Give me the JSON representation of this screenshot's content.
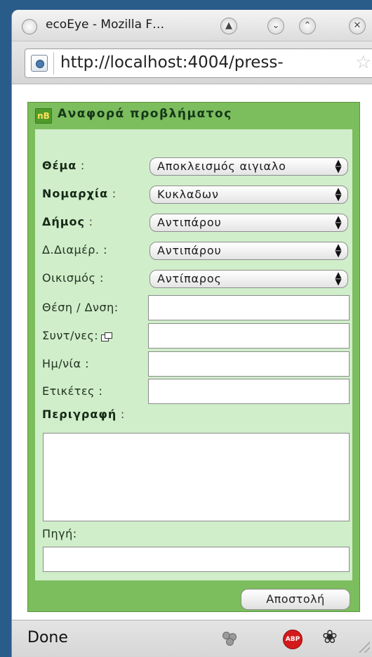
{
  "window": {
    "title": "ecoEye - Mozilla F…",
    "url": "http://localhost:4004/press-"
  },
  "panel": {
    "title": "Αναφορά προβλήματος",
    "logo_text": "nB"
  },
  "form": {
    "theme_label": "Θέμα",
    "theme_value": "Αποκλεισμός αιγιαλο",
    "prefecture_label": "Νομαρχία",
    "prefecture_value": "Κυκλαδων",
    "municipality_label": "Δήμος",
    "municipality_value": "Αντιπάρου",
    "district_label": "Δ.Διαμέρ. :",
    "district_value": "Αντιπάρου",
    "settlement_label": "Οικισμός :",
    "settlement_value": "Αντίπαρος",
    "location_label": "Θέση / Δνση:",
    "location_value": "",
    "coords_label": "Συντ/νες:",
    "coords_value": "",
    "date_label": "Ημ/νία :",
    "date_value": "",
    "tags_label": "Ετικέτες :",
    "tags_value": "",
    "description_label": "Περιγραφή",
    "description_value": "",
    "source_label": "Πηγή:",
    "source_value": "",
    "colon": ":",
    "submit_label": "Αποστολή"
  },
  "status": {
    "text": "Done",
    "abp_text": "ABP"
  },
  "icons": [
    "window-menu-icon",
    "shade-icon",
    "minimize-icon",
    "maximize-icon",
    "close-icon",
    "site-identity-icon",
    "bookmark-star-icon",
    "ecoeye-logo-icon",
    "coordinates-picker-icon",
    "status-network-icon",
    "adblock-icon",
    "firebug-icon",
    "resize-grip-icon"
  ],
  "colors": {
    "panel_border": "#7cbd5d",
    "panel_body": "#cfeec9",
    "abp_red": "#d41a1a"
  }
}
